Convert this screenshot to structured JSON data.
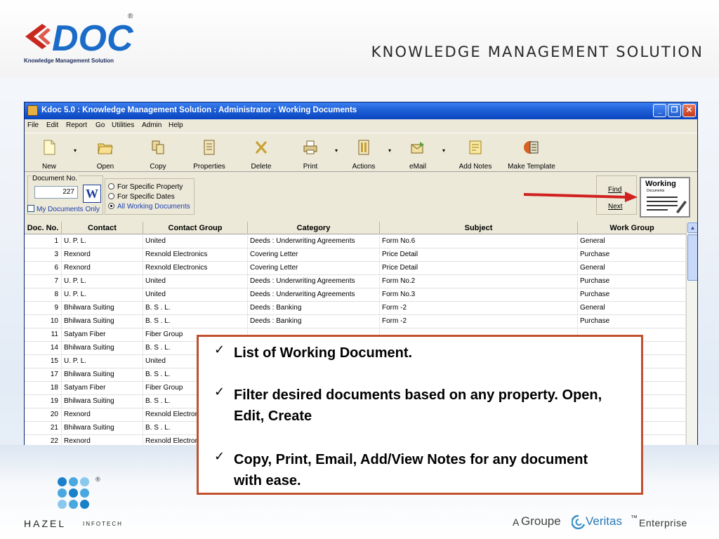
{
  "slide": {
    "logo_text": "DOC",
    "logo_tagline": "Knowledge Management Solution",
    "reg_mark": "®",
    "title": "KNOWLEDGE MANAGEMENT SOLUTION"
  },
  "window": {
    "title": "Kdoc 5.0 : Knowledge Management Solution : Administrator : Working Documents",
    "controls": {
      "minimize": "_",
      "maximize": "❐",
      "close": "✕"
    }
  },
  "menu": [
    "File",
    "Edit",
    "Report",
    "Go",
    "Utilities",
    "Admin",
    "Help"
  ],
  "toolbar": [
    {
      "label": "New",
      "icon": "new-document-icon",
      "dropdown": true
    },
    {
      "label": "Open",
      "icon": "folder-icon",
      "dropdown": false
    },
    {
      "label": "Copy",
      "icon": "copy-icon",
      "dropdown": false
    },
    {
      "label": "Properties",
      "icon": "properties-icon",
      "dropdown": false
    },
    {
      "label": "Delete",
      "icon": "delete-icon",
      "dropdown": false
    },
    {
      "label": "Print",
      "icon": "printer-icon",
      "dropdown": true
    },
    {
      "label": "Actions",
      "icon": "actions-icon",
      "dropdown": true
    },
    {
      "label": "eMail",
      "icon": "email-icon",
      "dropdown": true
    },
    {
      "label": "Add Notes",
      "icon": "notes-icon",
      "dropdown": false
    },
    {
      "label": "Make Template",
      "icon": "template-icon",
      "dropdown": false
    }
  ],
  "filter": {
    "docno_label": "Document No.",
    "docno_value": "227",
    "word_icon": "W",
    "my_docs_label": "My Documents Only",
    "radio_options": [
      "For Specific Property",
      "For Specific Dates",
      "All Working Documents"
    ],
    "radio_selected": 2,
    "find_label": "Find",
    "next_label": "Next",
    "working_title": "Working",
    "working_sub": "Documents"
  },
  "grid": {
    "columns": [
      "Doc. No.",
      "Contact",
      "Contact Group",
      "Category",
      "Subject",
      "Work Group"
    ],
    "rows": [
      [
        "1",
        "U. P. L.",
        "United",
        "Deeds : Underwriting Agreements",
        "Form No.6",
        "General"
      ],
      [
        "3",
        "Rexnord",
        "Rexnold Electronics",
        "Covering Letter",
        "Price Detail",
        "Purchase"
      ],
      [
        "6",
        "Rexnord",
        "Rexnold Electronics",
        "Covering Letter",
        "Price Detail",
        "General"
      ],
      [
        "7",
        "U. P. L.",
        "United",
        "Deeds : Underwriting Agreements",
        "Form No.2",
        "Purchase"
      ],
      [
        "8",
        "U. P. L.",
        "United",
        "Deeds : Underwriting Agreements",
        "Form No.3",
        "Purchase"
      ],
      [
        "9",
        "Bhilwara Suiting",
        "B. S . L.",
        "Deeds : Banking",
        "Form -2",
        "General"
      ],
      [
        "10",
        "Bhilwara Suiting",
        "B. S . L.",
        "Deeds : Banking",
        "Form -2",
        "Purchase"
      ],
      [
        "11",
        "Satyam Fiber",
        "Fiber Group",
        "",
        "",
        ""
      ],
      [
        "14",
        "Bhilwara Suiting",
        "B. S . L.",
        "",
        "",
        ""
      ],
      [
        "15",
        "U. P. L.",
        "United",
        "",
        "",
        ""
      ],
      [
        "17",
        "Bhilwara Suiting",
        "B. S . L.",
        "",
        "",
        ""
      ],
      [
        "18",
        "Satyam Fiber",
        "Fiber Group",
        "",
        "",
        ""
      ],
      [
        "19",
        "Bhilwara Suiting",
        "B. S . L.",
        "",
        "",
        ""
      ],
      [
        "20",
        "Rexnord",
        "Rexnold Electronics",
        "",
        "",
        ""
      ],
      [
        "21",
        "Bhilwara Suiting",
        "B. S . L.",
        "",
        "",
        ""
      ],
      [
        "22",
        "Rexnord",
        "Rexnold Electronics",
        "",
        "",
        ""
      ]
    ]
  },
  "callout": {
    "items": [
      "List of Working Document.",
      "Filter desired documents based on any property. Open, Edit, Create",
      "Copy, Print, Email, Add/View Notes for any document with ease."
    ],
    "check": "✓"
  },
  "footer": {
    "hazel_name": "HAZEL",
    "hazel_sub": "INFOTECH",
    "hazel_reg": "®",
    "groupe_a": "A",
    "groupe_name": "Groupe",
    "groupe_veritas": "Veritas",
    "groupe_tm": "™",
    "groupe_enterprise": "Enterprise"
  },
  "colors": {
    "titlebar": "#1e5fd6",
    "callout_border": "#c0502e",
    "accent_blue": "#1a3cb0"
  }
}
